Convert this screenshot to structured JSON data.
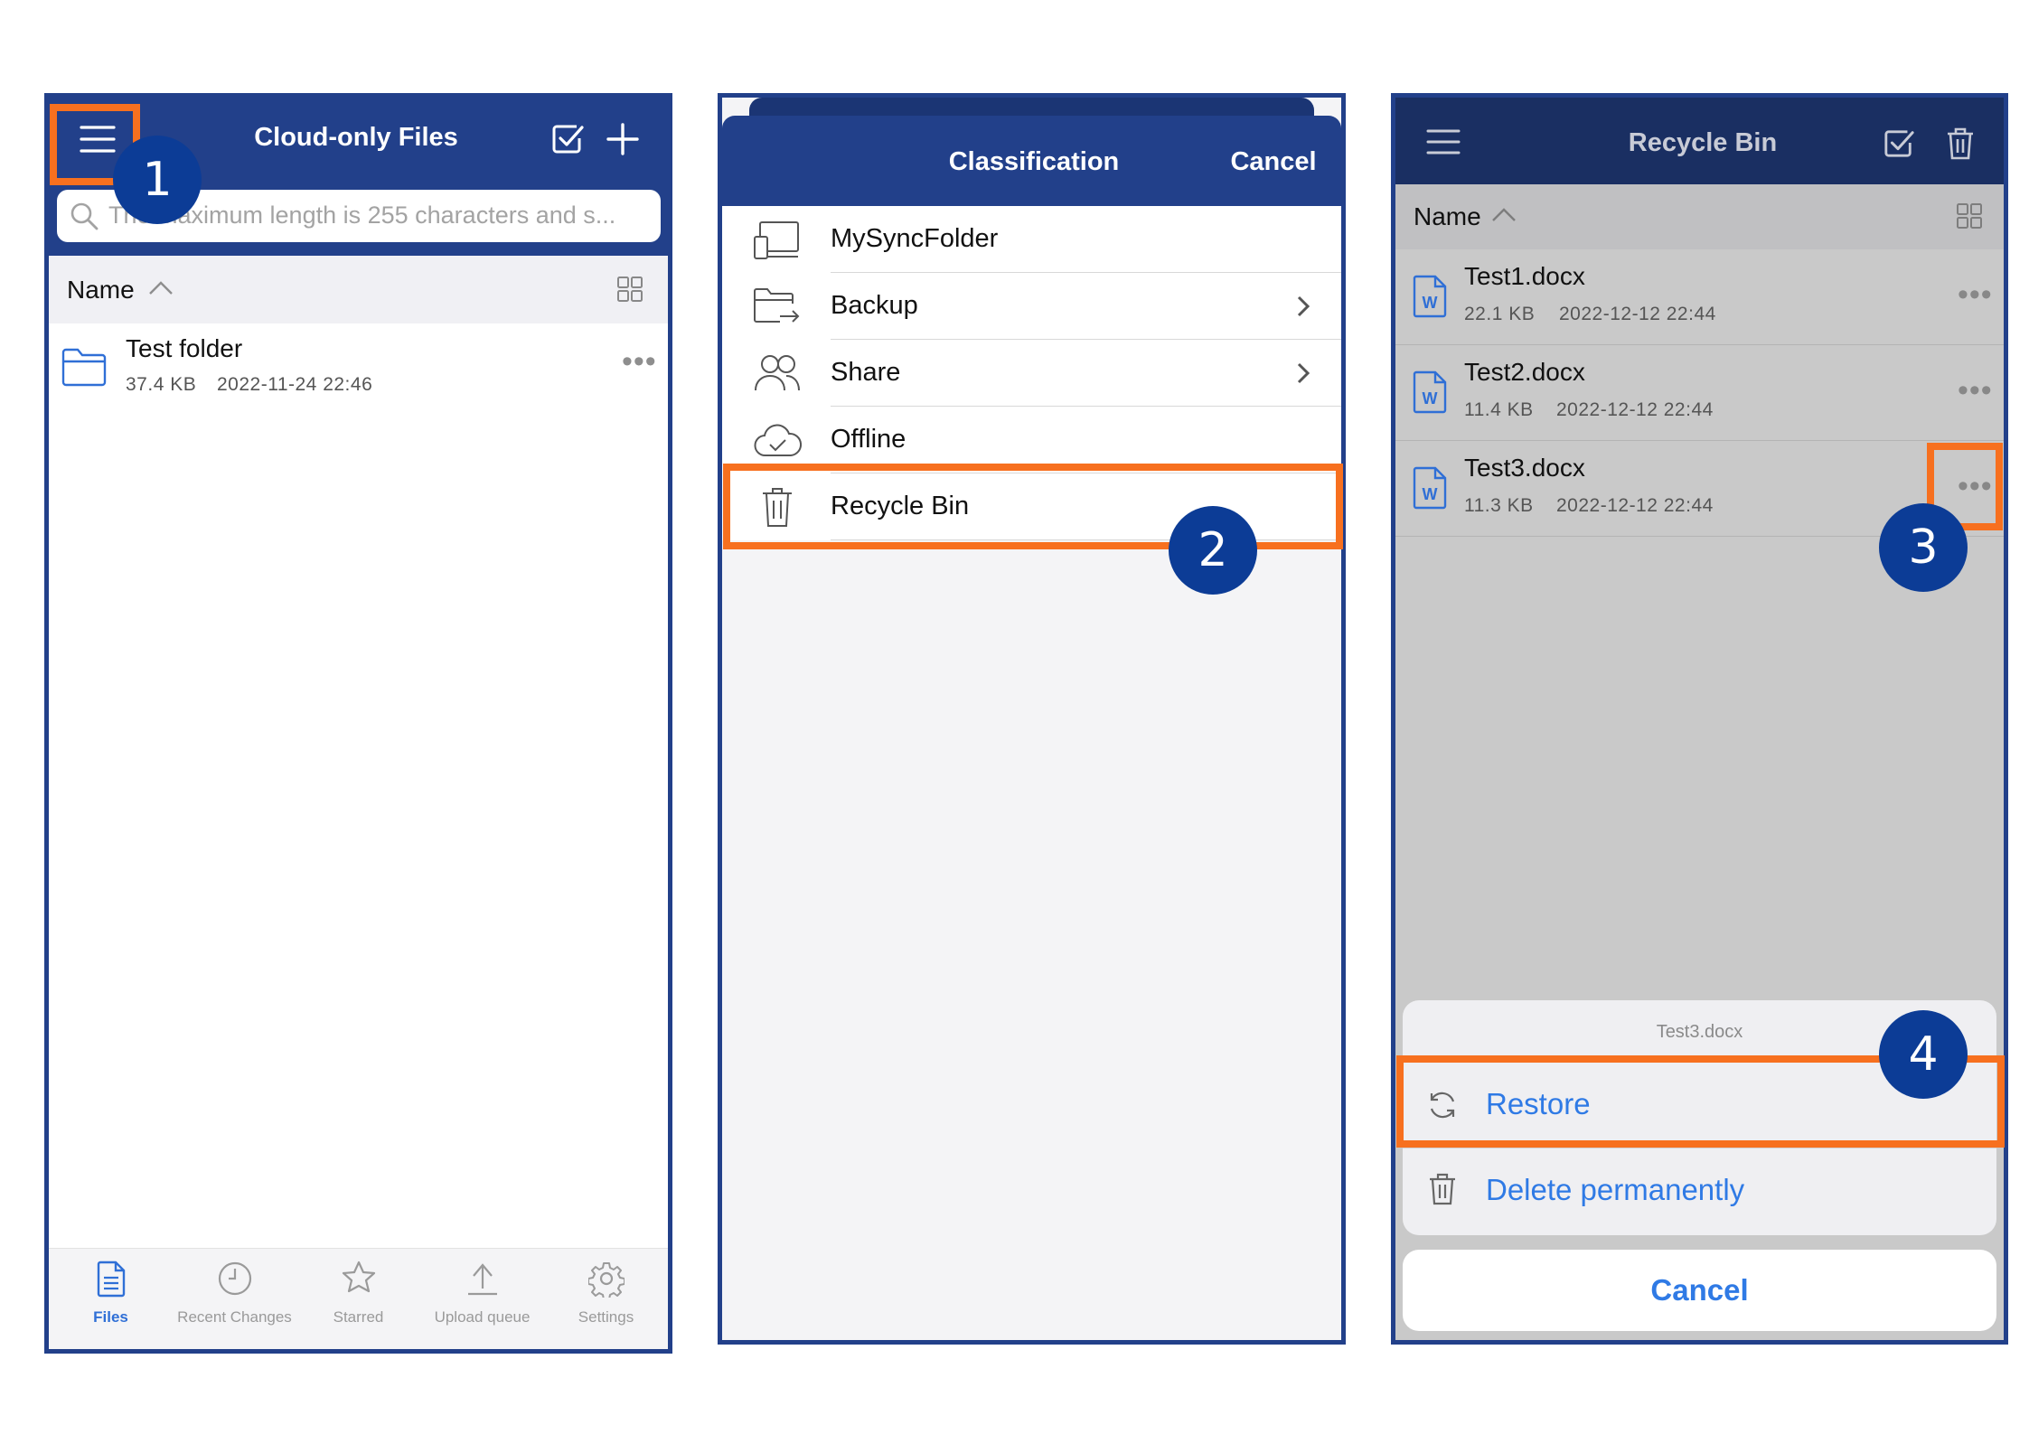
{
  "colors": {
    "nav_blue": "#22408a",
    "highlight_orange": "#f7701f",
    "badge_blue": "#0c3c96",
    "link_blue": "#2f7ae5"
  },
  "panel1": {
    "title": "Cloud-only Files",
    "search_placeholder": "The maximum length is 255 characters and s...",
    "sort_label": "Name",
    "rows": [
      {
        "name": "Test folder",
        "size": "37.4 KB",
        "date": "2022-11-24 22:46",
        "icon": "folder-icon"
      }
    ],
    "more_label": "•••",
    "tabs": [
      {
        "label": "Files",
        "icon": "document-icon",
        "active": true
      },
      {
        "label": "Recent Changes",
        "icon": "clock-icon",
        "active": false
      },
      {
        "label": "Starred",
        "icon": "star-icon",
        "active": false
      },
      {
        "label": "Upload queue",
        "icon": "upload-icon",
        "active": false
      },
      {
        "label": "Settings",
        "icon": "gear-icon",
        "active": false
      }
    ]
  },
  "panel2": {
    "title": "Classification",
    "cancel": "Cancel",
    "items": [
      {
        "label": "MySyncFolder",
        "icon": "device-icon",
        "has_chevron": false
      },
      {
        "label": "Backup",
        "icon": "backup-folder-icon",
        "has_chevron": true
      },
      {
        "label": "Share",
        "icon": "people-icon",
        "has_chevron": true
      },
      {
        "label": "Offline",
        "icon": "cloud-check-icon",
        "has_chevron": false
      },
      {
        "label": "Recycle Bin",
        "icon": "trash-icon",
        "has_chevron": false
      }
    ]
  },
  "panel3": {
    "title": "Recycle Bin",
    "sort_label": "Name",
    "rows": [
      {
        "name": "Test1.docx",
        "size": "22.1 KB",
        "date": "2022-12-12 22:44",
        "icon": "word-doc-icon"
      },
      {
        "name": "Test2.docx",
        "size": "11.4 KB",
        "date": "2022-12-12 22:44",
        "icon": "word-doc-icon"
      },
      {
        "name": "Test3.docx",
        "size": "11.3 KB",
        "date": "2022-12-12 22:44",
        "icon": "word-doc-icon"
      }
    ],
    "more_label": "•••",
    "sheet_title": "Test3.docx",
    "restore": "Restore",
    "delete": "Delete permanently",
    "cancel": "Cancel"
  },
  "steps": [
    "1",
    "2",
    "3",
    "4"
  ]
}
